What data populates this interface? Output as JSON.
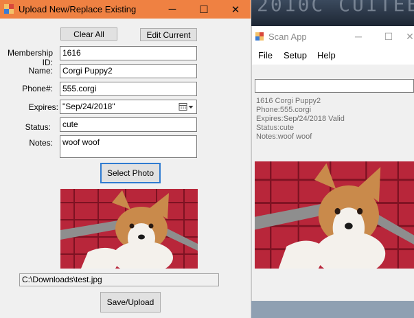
{
  "upload_window": {
    "title": "Upload New/Replace Existing",
    "controls": {
      "minimize": "─",
      "maximize": "☐",
      "close": "✕"
    },
    "buttons": {
      "clear_all": "Clear All",
      "edit_current": "Edit Current",
      "select_photo": "Select Photo",
      "save_upload": "Save/Upload"
    },
    "form": {
      "membership_id": {
        "label": "Membership ID:",
        "value": "1616"
      },
      "name": {
        "label": "Name:",
        "value": "Corgi Puppy2"
      },
      "phone": {
        "label": "Phone#:",
        "value": "555.corgi"
      },
      "expires": {
        "label": "Expires:",
        "value": "\"Sep/24/2018\""
      },
      "status": {
        "label": "Status:",
        "value": "cute"
      },
      "notes": {
        "label": "Notes:",
        "value": "woof woof"
      }
    },
    "photo_path": "C:\\Downloads\\test.jpg",
    "photo_icon": "corgi-photo",
    "title_color": "#ef8142"
  },
  "scan_window": {
    "title": "Scan App",
    "controls": {
      "minimize": "─",
      "maximize": "☐",
      "close": "✕"
    },
    "menu": [
      "File",
      "Setup",
      "Help"
    ],
    "scan_value": "",
    "info_lines": [
      "1616 Corgi Puppy2",
      "Phone:555.corgi",
      "Expires:Sep/24/2018 Valid",
      "Status:cute",
      "Notes:woof woof"
    ],
    "photo_icon": "corgi-photo"
  }
}
